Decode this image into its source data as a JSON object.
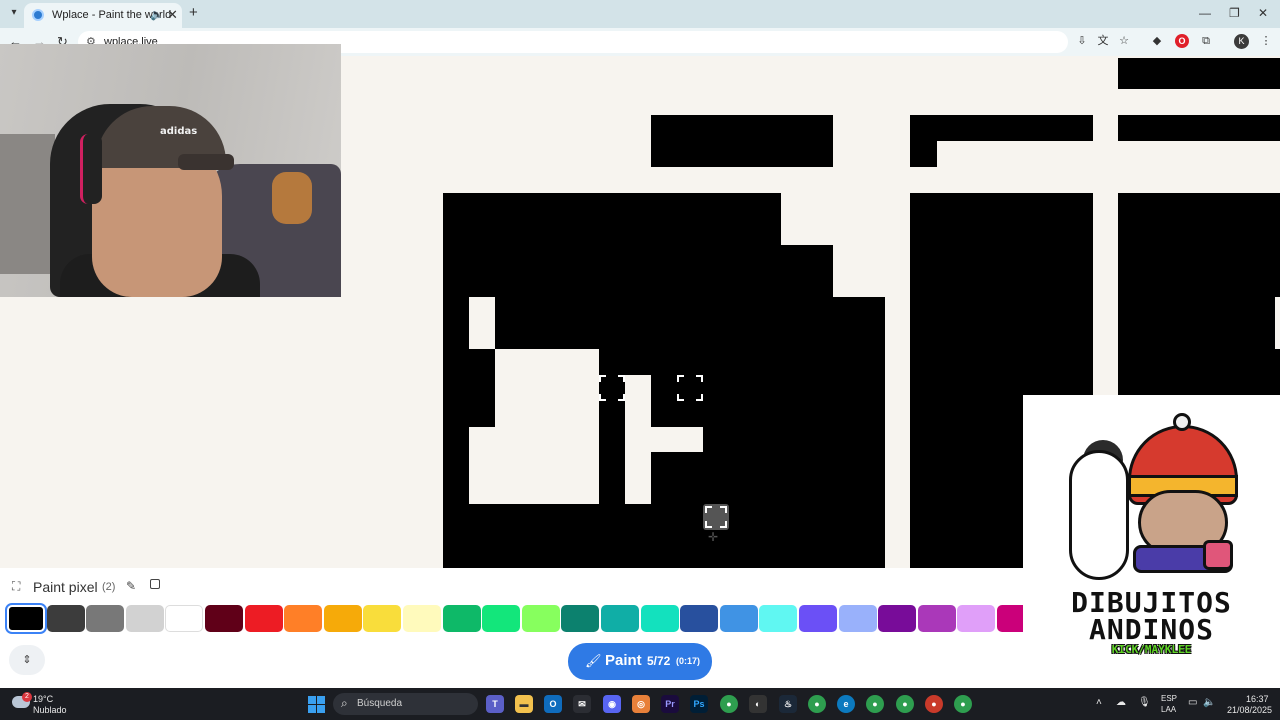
{
  "browser": {
    "tab_title": "Wplace - Paint the world",
    "url": "wplace.live",
    "profile_initial": "K",
    "icons": [
      "tab-menu-icon",
      "globe-icon",
      "audio-icon",
      "close-icon",
      "plus-icon",
      "back-icon",
      "forward-icon",
      "reload-icon",
      "site-info-icon",
      "install-icon",
      "translate-icon",
      "star-icon",
      "extension-icon",
      "opera-icon",
      "puzzle-icon",
      "menu-dots-icon"
    ]
  },
  "paint_panel": {
    "title": "Paint pixel",
    "count": "(2)",
    "palette": [
      "#000000",
      "#3c3c3c",
      "#787878",
      "#d2d2d2",
      "#ffffff",
      "#600018",
      "#ed1c24",
      "#ff7f27",
      "#f6aa09",
      "#f9dd3b",
      "#fffabc",
      "#0eb968",
      "#13e67b",
      "#87ff5e",
      "#0c816e",
      "#10aea6",
      "#13e1be",
      "#28509e",
      "#4093e4",
      "#60f7f2",
      "#6b50f6",
      "#99b1fb",
      "#780c99",
      "#aa38b9",
      "#e09ff9",
      "#cb007a"
    ],
    "selected_color": "#000000"
  },
  "paint_button": {
    "label": "Paint",
    "count": "5/72",
    "timer": "(0:17)"
  },
  "overlay_logo": {
    "line1": "DIBUJITOS",
    "line2": "ANDINOS",
    "handle": "KICK/MAYKLEE"
  },
  "taskbar": {
    "weather_badge": "2",
    "temperature": "19°C",
    "weather": "Nublado",
    "search_placeholder": "Búsqueda",
    "lang": "ESP",
    "layout": "LAA",
    "time": "16:37",
    "date": "21/08/2025"
  }
}
